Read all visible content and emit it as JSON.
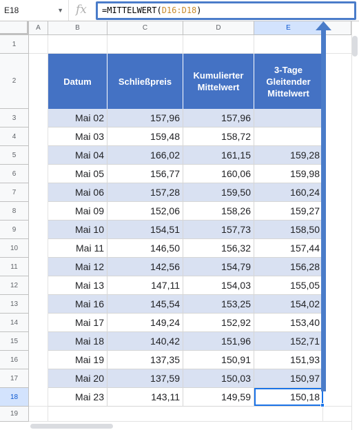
{
  "formula_bar": {
    "cell_ref": "E18",
    "fx_label": "fx",
    "formula_prefix": "=MITTELWERT(",
    "formula_range": "D16:D18",
    "formula_suffix": ")"
  },
  "columns": [
    "A",
    "B",
    "C",
    "D",
    "E"
  ],
  "row_numbers": [
    "1",
    "2",
    "3",
    "4",
    "5",
    "6",
    "7",
    "8",
    "9",
    "10",
    "11",
    "12",
    "13",
    "14",
    "15",
    "16",
    "17",
    "18",
    "19"
  ],
  "table": {
    "headers": {
      "datum": "Datum",
      "schluss": "Schließpreis",
      "kum1": "Kumulierter",
      "kum2": "Mittelwert",
      "gl1": "3-Tage",
      "gl2": "Gleitender",
      "gl3": "Mittelwert"
    },
    "rows": [
      {
        "datum": "Mai 02",
        "preis": "157,96",
        "kum": "157,96",
        "gl": ""
      },
      {
        "datum": "Mai 03",
        "preis": "159,48",
        "kum": "158,72",
        "gl": ""
      },
      {
        "datum": "Mai 04",
        "preis": "166,02",
        "kum": "161,15",
        "gl": "159,28"
      },
      {
        "datum": "Mai 05",
        "preis": "156,77",
        "kum": "160,06",
        "gl": "159,98"
      },
      {
        "datum": "Mai 06",
        "preis": "157,28",
        "kum": "159,50",
        "gl": "160,24"
      },
      {
        "datum": "Mai 09",
        "preis": "152,06",
        "kum": "158,26",
        "gl": "159,27"
      },
      {
        "datum": "Mai 10",
        "preis": "154,51",
        "kum": "157,73",
        "gl": "158,50"
      },
      {
        "datum": "Mai 11",
        "preis": "146,50",
        "kum": "156,32",
        "gl": "157,44"
      },
      {
        "datum": "Mai 12",
        "preis": "142,56",
        "kum": "154,79",
        "gl": "156,28"
      },
      {
        "datum": "Mai 13",
        "preis": "147,11",
        "kum": "154,03",
        "gl": "155,05"
      },
      {
        "datum": "Mai 16",
        "preis": "145,54",
        "kum": "153,25",
        "gl": "154,02"
      },
      {
        "datum": "Mai 17",
        "preis": "149,24",
        "kum": "152,92",
        "gl": "153,40"
      },
      {
        "datum": "Mai 18",
        "preis": "140,42",
        "kum": "151,96",
        "gl": "152,71"
      },
      {
        "datum": "Mai 19",
        "preis": "137,35",
        "kum": "150,91",
        "gl": "151,93"
      },
      {
        "datum": "Mai 20",
        "preis": "137,59",
        "kum": "150,03",
        "gl": "150,97"
      },
      {
        "datum": "Mai 23",
        "preis": "143,11",
        "kum": "149,59",
        "gl": "150,18"
      }
    ]
  },
  "colors": {
    "header_fill": "#4472c4",
    "band_fill": "#d9e1f2",
    "selection": "#1a73e8",
    "arrow": "#4a7cc9"
  }
}
